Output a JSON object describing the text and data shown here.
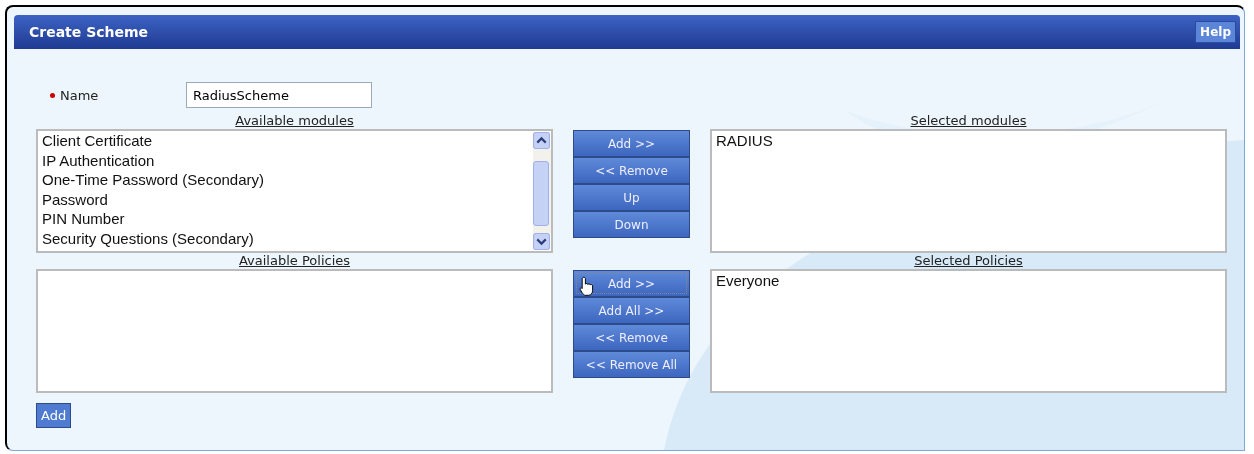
{
  "panel": {
    "title": "Create Scheme",
    "help": "Help"
  },
  "name_field": {
    "label": "Name",
    "required": true,
    "value": "RadiusScheme"
  },
  "modules": {
    "available_label": "Available modules",
    "available": [
      "Client Certificate",
      "IP Authentication",
      "One-Time Password (Secondary)",
      "Password",
      "PIN Number",
      "Security Questions (Secondary)"
    ],
    "buttons": [
      {
        "label": "Add >>",
        "focused": false
      },
      {
        "label": "<< Remove",
        "focused": false
      },
      {
        "label": "Up",
        "focused": false
      },
      {
        "label": "Down",
        "focused": false
      }
    ],
    "selected_label": "Selected modules",
    "selected": [
      "RADIUS"
    ]
  },
  "policies": {
    "available_label": "Available Policies",
    "buttons": [
      {
        "label": "Add >>",
        "focused": true
      },
      {
        "label": "Add All >>",
        "focused": false
      },
      {
        "label": "<< Remove",
        "focused": false
      },
      {
        "label": "<< Remove All",
        "focused": false
      }
    ],
    "selected_label": "Selected Policies",
    "selected": [
      "Everyone"
    ]
  },
  "add_button": "Add"
}
